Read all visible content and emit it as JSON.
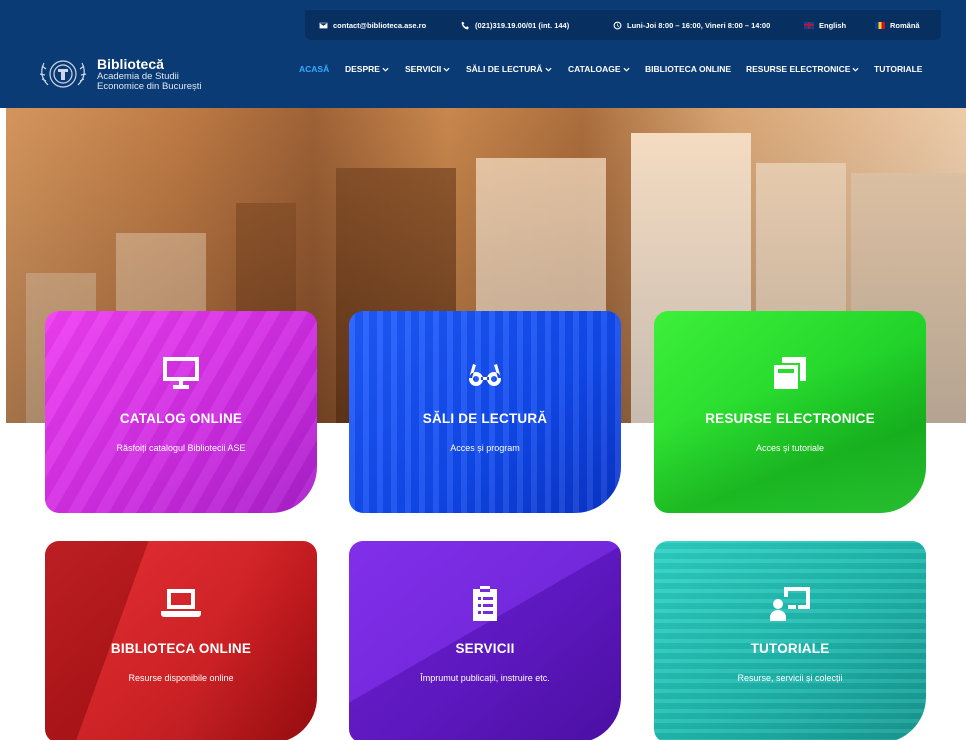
{
  "topbar": {
    "email": "contact@biblioteca.ase.ro",
    "phone": "(021)319.19.00/01 (int. 144)",
    "hours": "Luni-Joi 8:00 – 16:00, Vineri 8:00 – 14:00",
    "lang_en": "English",
    "lang_ro": "Română"
  },
  "logo": {
    "title": "Bibliotecă",
    "subtitle_line1": "Academia de Studii",
    "subtitle_line2": "Economice din București"
  },
  "nav": {
    "items": [
      {
        "label": "ACASĂ",
        "dropdown": false,
        "active": true
      },
      {
        "label": "DESPRE",
        "dropdown": true
      },
      {
        "label": "SERVICII",
        "dropdown": true
      },
      {
        "label": "SĂLI DE LECTURĂ",
        "dropdown": true
      },
      {
        "label": "CATALOAGE",
        "dropdown": true
      },
      {
        "label": "BIBLIOTECA ONLINE",
        "dropdown": false
      },
      {
        "label": "RESURSE ELECTRONICE",
        "dropdown": true
      },
      {
        "label": "TUTORIALE",
        "dropdown": false
      }
    ]
  },
  "cards": [
    {
      "title": "CATALOG ONLINE",
      "subtitle": "Răsfoiți catalogul Bibliotecii ASE",
      "icon": "monitor-icon",
      "color": "#e536ec"
    },
    {
      "title": "SĂLI DE LECTURĂ",
      "subtitle": "Acces și program",
      "icon": "glasses-icon",
      "color": "#1a55f5"
    },
    {
      "title": "RESURSE ELECTRONICE",
      "subtitle": "Acces și tutoriale",
      "icon": "copy-icon",
      "color": "#2bdc2c"
    },
    {
      "title": "BIBLIOTECA ONLINE",
      "subtitle": "Resurse disponibile online",
      "icon": "laptop-icon",
      "color": "#d51c20"
    },
    {
      "title": "SERVICII",
      "subtitle": "Împrumut publicații, instruire etc.",
      "icon": "clipboard-list-icon",
      "color": "#6b1ddb"
    },
    {
      "title": "TUTORIALE",
      "subtitle": "Resurse, servicii și colecții",
      "icon": "chalkboard-teacher-icon",
      "color": "#22c2b7"
    }
  ],
  "colors": {
    "header_bg": "#0b3b74",
    "topbar_bg": "#072f60",
    "nav_active": "#33aaff"
  }
}
